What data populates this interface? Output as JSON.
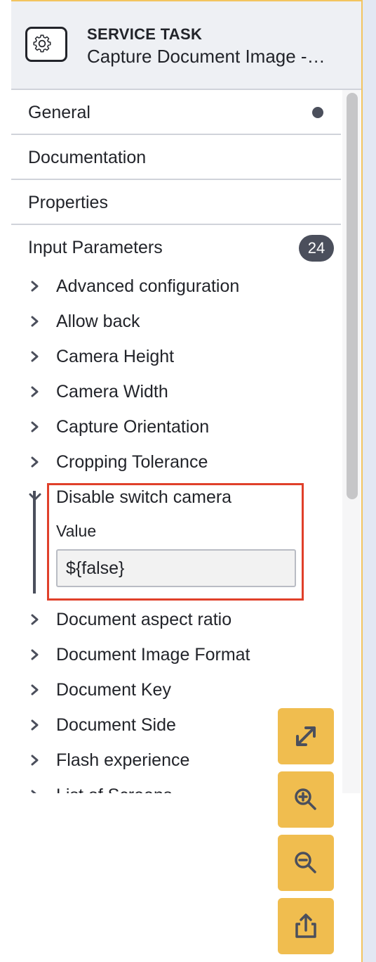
{
  "header": {
    "type_label": "SERVICE TASK",
    "name": "Capture Document Image -…",
    "icon": "gear-icon"
  },
  "groups": [
    {
      "label": "General",
      "has_dot": true
    },
    {
      "label": "Documentation"
    },
    {
      "label": "Properties"
    }
  ],
  "input_parameters": {
    "label": "Input Parameters",
    "count": "24",
    "items": [
      {
        "label": "Advanced configuration",
        "expanded": false
      },
      {
        "label": "Allow back",
        "expanded": false
      },
      {
        "label": "Camera Height",
        "expanded": false
      },
      {
        "label": "Camera Width",
        "expanded": false
      },
      {
        "label": "Capture Orientation",
        "expanded": false
      },
      {
        "label": "Cropping Tolerance",
        "expanded": false
      },
      {
        "label": "Disable switch camera",
        "expanded": true
      },
      {
        "label": "Document aspect ratio",
        "expanded": false
      },
      {
        "label": "Document Image Format",
        "expanded": false
      },
      {
        "label": "Document Key",
        "expanded": false
      },
      {
        "label": "Document Side",
        "expanded": false
      },
      {
        "label": "Flash experience",
        "expanded": false
      },
      {
        "label": "List of Screens",
        "expanded": false
      }
    ],
    "expanded_field": {
      "label": "Value",
      "value": "${false}"
    }
  },
  "toolbar": {
    "buttons": [
      "fullscreen-icon",
      "zoom-in-icon",
      "zoom-out-icon",
      "export-icon"
    ]
  },
  "colors": {
    "accent": "#f0bd4f",
    "highlight": "#e0402a",
    "badge": "#4b4f5c"
  }
}
